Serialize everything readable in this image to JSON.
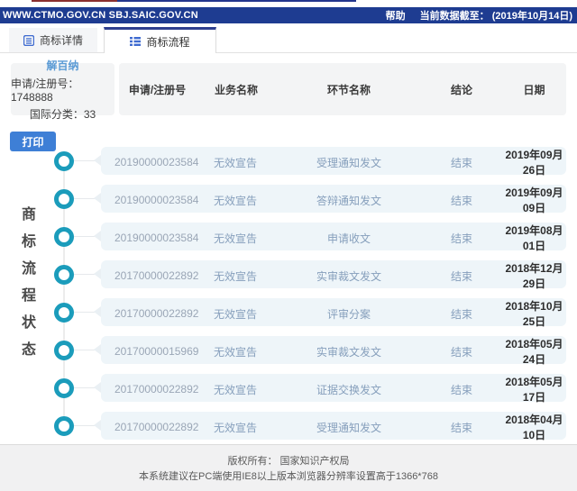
{
  "topbar": {
    "urls": "WWW.CTMO.GOV.CN SBJ.SAIC.GOV.CN",
    "help": "帮助",
    "data_cutoff": "当前数据截至： (2019年10月14日)"
  },
  "tabs": [
    {
      "label": "商标详情",
      "active": false
    },
    {
      "label": "商标流程",
      "active": true
    }
  ],
  "trademark": {
    "name": "解百纳",
    "reg_no": "申请/注册号：1748888",
    "intl_class": "国际分类：33"
  },
  "print_label": "打印",
  "side_title": "商标流程状态",
  "process_table": {
    "headers": [
      "申请/注册号",
      "业务名称",
      "环节名称",
      "结论",
      "日期"
    ],
    "rows": [
      {
        "app_no": "20190000023584",
        "business": "无效宣告",
        "step": "受理通知发文",
        "conclusion": "结束",
        "date": "2019年09月26日"
      },
      {
        "app_no": "20190000023584",
        "business": "无效宣告",
        "step": "答辩通知发文",
        "conclusion": "结束",
        "date": "2019年09月09日"
      },
      {
        "app_no": "20190000023584",
        "business": "无效宣告",
        "step": "申请收文",
        "conclusion": "结束",
        "date": "2019年08月01日"
      },
      {
        "app_no": "20170000022892",
        "business": "无效宣告",
        "step": "实审裁文发文",
        "conclusion": "结束",
        "date": "2018年12月29日"
      },
      {
        "app_no": "20170000022892",
        "business": "无效宣告",
        "step": "评审分案",
        "conclusion": "结束",
        "date": "2018年10月25日"
      },
      {
        "app_no": "20170000015969",
        "business": "无效宣告",
        "step": "实审裁文发文",
        "conclusion": "结束",
        "date": "2018年05月24日"
      },
      {
        "app_no": "20170000022892",
        "business": "无效宣告",
        "step": "证据交换发文",
        "conclusion": "结束",
        "date": "2018年05月17日"
      },
      {
        "app_no": "20170000022892",
        "business": "无效宣告",
        "step": "受理通知发文",
        "conclusion": "结束",
        "date": "2018年04月10日"
      }
    ]
  },
  "footer": {
    "line1": "版权所有： 国家知识产权局",
    "line2": "本系统建议在PC端使用IE8以上版本浏览器分辨率设置高于1366*768"
  },
  "colors": {
    "topbar_navy": "#1e3c91",
    "button_blue": "#3e7fd6",
    "node_ring_teal": "#1b9cbb",
    "trademark_name_blue": "#5b9bd5",
    "row_bg": "#eef5f9"
  }
}
